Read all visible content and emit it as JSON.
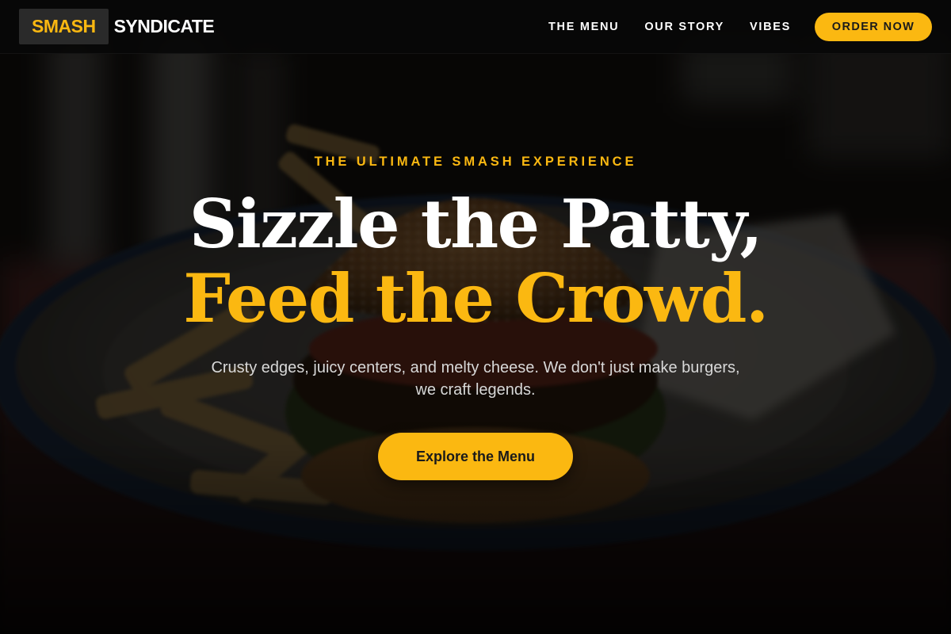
{
  "brand": {
    "logo_highlight": "SMASH",
    "logo_rest": "SYNDICATE"
  },
  "nav": {
    "links": [
      "THE MENU",
      "OUR STORY",
      "VIBES"
    ],
    "order_button": "ORDER NOW"
  },
  "hero": {
    "eyebrow": "THE ULTIMATE SMASH EXPERIENCE",
    "headline_line1": "Sizzle the Patty,",
    "headline_line2": "Feed the Crowd.",
    "subtitle": "Crusty edges, juicy centers, and melty cheese. We don't just make burgers, we craft legends.",
    "cta": "Explore the Menu",
    "background_image": "burger-with-fries-photo"
  },
  "colors": {
    "accent": "#fbb811",
    "nav_bg": "#080808",
    "text_primary": "#ffffff",
    "text_secondary": "#d8d8d8"
  }
}
